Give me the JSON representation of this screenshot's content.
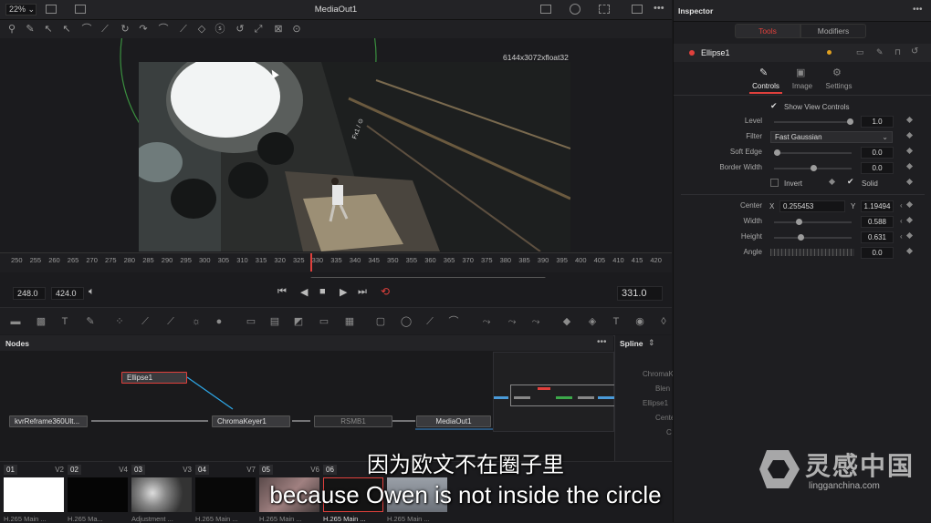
{
  "viewer": {
    "zoom": "22%",
    "title": "MediaOut1",
    "resolution": "6144x3072xfloat32",
    "ruler_ticks": [
      "250",
      "255",
      "260",
      "265",
      "270",
      "275",
      "280",
      "285",
      "290",
      "295",
      "300",
      "305",
      "310",
      "315",
      "320",
      "325",
      "330",
      "335",
      "340",
      "345",
      "350",
      "355",
      "360",
      "365",
      "370",
      "375",
      "380",
      "385",
      "390",
      "395",
      "400",
      "405",
      "410",
      "415",
      "420"
    ],
    "in_point": "248.0",
    "out_point": "424.0",
    "current_frame": "331.0"
  },
  "nodes": {
    "panel_title": "Nodes",
    "items": {
      "ellipse": "Ellipse1",
      "reframe": "kvrReframe360Ult...",
      "chromakeyer": "ChromaKeyer1",
      "rsmb": "RSMB1",
      "mediaout": "MediaOut1"
    }
  },
  "spline": {
    "title": "Spline",
    "items": [
      "ChromaK",
      "Blen",
      "Ellipse1",
      "Cente",
      "C"
    ]
  },
  "clips": [
    {
      "num": "01",
      "track": "V2",
      "label": "H.265 Main ..."
    },
    {
      "num": "02",
      "track": "V4",
      "label": "H.265 Ma..."
    },
    {
      "num": "03",
      "track": "V3",
      "label": "Adjustment ..."
    },
    {
      "num": "04",
      "track": "V7",
      "label": "H.265 Main ..."
    },
    {
      "num": "05",
      "track": "V6",
      "label": "H.265 Main ..."
    },
    {
      "num": "06",
      "track": "",
      "label": "H.265 Main ..."
    },
    {
      "num": "",
      "track": "",
      "label": "H.265 Main ..."
    }
  ],
  "inspector": {
    "title": "Inspector",
    "tab_tools": "Tools",
    "tab_modifiers": "Modifiers",
    "node_name": "Ellipse1",
    "subtab_controls": "Controls",
    "subtab_image": "Image",
    "subtab_settings": "Settings",
    "show_view_controls": "Show View Controls",
    "level_label": "Level",
    "level_value": "1.0",
    "filter_label": "Filter",
    "filter_value": "Fast Gaussian",
    "soft_edge_label": "Soft Edge",
    "soft_edge_value": "0.0",
    "border_width_label": "Border Width",
    "border_width_value": "0.0",
    "invert_label": "Invert",
    "solid_label": "Solid",
    "center_label": "Center",
    "center_x_label": "X",
    "center_x_value": "0.255453",
    "center_y_label": "Y",
    "center_y_value": "1.19494",
    "width_label": "Width",
    "width_value": "0.588",
    "height_label": "Height",
    "height_value": "0.631",
    "angle_label": "Angle",
    "angle_value": "0.0"
  },
  "subtitles": {
    "chinese": "因为欧文不在圈子里",
    "english": "because Owen is not inside the circle"
  },
  "watermark": {
    "brand_cn": "灵感中国",
    "brand_url": "lingganchina.com"
  },
  "colors": {
    "accent_red": "#e0403c",
    "ellipse_green": "#4caf50",
    "background": "#1b1b1e"
  }
}
